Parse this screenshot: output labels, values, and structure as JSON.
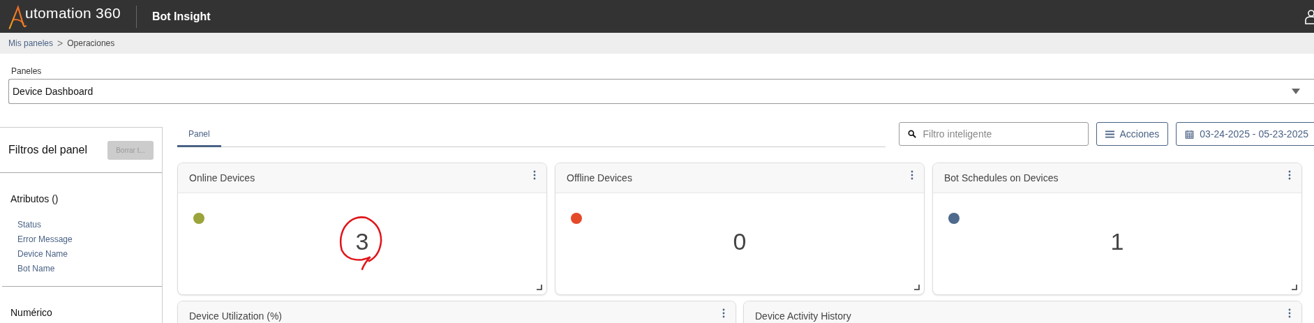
{
  "header": {
    "brand": "utomation 360",
    "product": "Bot Insight"
  },
  "breadcrumb": [
    {
      "label": "Mis paneles",
      "kind": "link"
    },
    {
      "label": ">",
      "kind": "separator"
    },
    {
      "label": "Operaciones",
      "kind": "current"
    }
  ],
  "dashboard_select": {
    "label": "Paneles",
    "value": "Device Dashboard"
  },
  "sidebar": {
    "title": "Filtros del panel",
    "clear_button": {
      "label": "Borrar t...",
      "disabled": true
    },
    "sections": [
      {
        "title": "Atributos ()",
        "items": [
          "Status",
          "Error Message",
          "Device Name",
          "Bot Name"
        ]
      },
      {
        "title": "Numérico"
      }
    ]
  },
  "tabs": [
    {
      "label": "Panel",
      "selected": true
    }
  ],
  "search": {
    "placeholder": "Filtro inteligente"
  },
  "actions_button": {
    "label": "Acciones"
  },
  "date_range": {
    "label": "03-24-2025 - 05-23-2025"
  },
  "kpi_cards": [
    {
      "title": "Online Devices",
      "color": "#9aa43a",
      "value": "3",
      "circled": true
    },
    {
      "title": "Offline Devices",
      "color": "#e4492a",
      "value": "0",
      "circled": false
    },
    {
      "title": "Bot Schedules on Devices",
      "color": "#4e6a8c",
      "value": "1",
      "circled": false
    }
  ],
  "chart_cards": [
    {
      "title": "Device Utilization (%)"
    },
    {
      "title": "Device Activity History"
    }
  ]
}
